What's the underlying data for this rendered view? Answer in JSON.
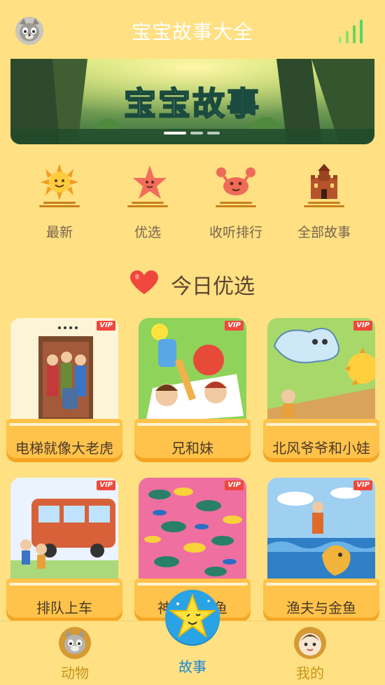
{
  "header": {
    "title": "宝宝故事大全",
    "avatar_icon": "cat-face-icon",
    "signal_icon": "signal-bars-icon"
  },
  "banner": {
    "text": "宝宝故事",
    "active_slide": 1,
    "slide_count": 3
  },
  "categories": [
    {
      "label": "最新",
      "icon": "sun-icon"
    },
    {
      "label": "优选",
      "icon": "starfish-icon"
    },
    {
      "label": "收听排行",
      "icon": "crab-icon"
    },
    {
      "label": "全部故事",
      "icon": "castle-icon"
    }
  ],
  "section": {
    "title": "今日优选",
    "icon": "heart-icon"
  },
  "stories": [
    {
      "name": "电梯就像大老虎",
      "badge": "VIP"
    },
    {
      "name": "兄和妹",
      "badge": "VIP"
    },
    {
      "name": "北风爷爷和小娃",
      "badge": "VIP"
    },
    {
      "name": "排队上车",
      "badge": "VIP"
    },
    {
      "name": "神奇的小鱼",
      "badge": "VIP"
    },
    {
      "name": "渔夫与金鱼",
      "badge": "VIP"
    }
  ],
  "nav": {
    "items": [
      {
        "label": "动物",
        "icon": "cat-face-icon"
      },
      {
        "label": "故事",
        "icon": "star-face-icon"
      },
      {
        "label": "我的",
        "icon": "baby-face-icon"
      }
    ],
    "active": "故事"
  },
  "colors": {
    "background": "#ffe082",
    "accent_blue": "#2aa3e6",
    "nav_label": "#c79318",
    "vip_red": "#f0473d",
    "card_plate": "#ffc24a"
  }
}
